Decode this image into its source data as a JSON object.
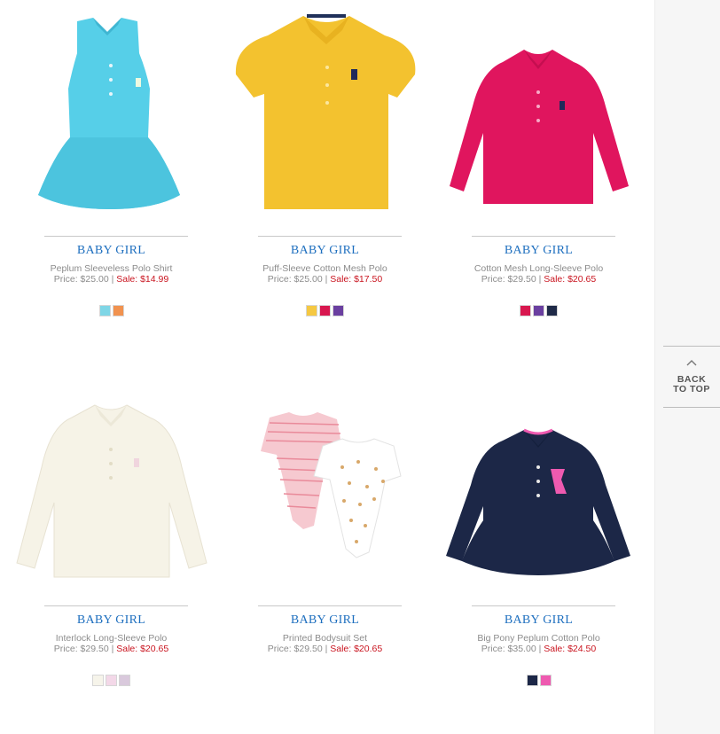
{
  "brand_color": "#1e6fbf",
  "sale_color": "#c9141f",
  "back_to_top": {
    "line1": "BACK",
    "line2": "TO TOP",
    "icon": "chevron-up-icon"
  },
  "products": [
    {
      "brand": "BABY GIRL",
      "name": "Peplum Sleeveless Polo Shirt",
      "price_label": "Price: $25.00",
      "separator": "|",
      "sale_label": "Sale: $14.99",
      "image": "turquoise sleeveless peplum polo",
      "swatches": [
        "#7fd6e6",
        "#f1924f"
      ]
    },
    {
      "brand": "BABY GIRL",
      "name": "Puff-Sleeve Cotton Mesh Polo",
      "price_label": "Price: $25.00",
      "separator": "|",
      "sale_label": "Sale: $17.50",
      "image": "yellow puff-sleeve polo",
      "swatches": [
        "#f5c842",
        "#d8174f",
        "#6a3fa0"
      ]
    },
    {
      "brand": "BABY GIRL",
      "name": "Cotton Mesh Long-Sleeve Polo",
      "price_label": "Price: $29.50",
      "separator": "|",
      "sale_label": "Sale: $20.65",
      "image": "pink long-sleeve polo",
      "swatches": [
        "#d8174f",
        "#6a3fa0",
        "#1f2a48"
      ]
    },
    {
      "brand": "BABY GIRL",
      "name": "Interlock Long-Sleeve Polo",
      "price_label": "Price: $29.50",
      "separator": "|",
      "sale_label": "Sale: $20.65",
      "image": "cream long-sleeve polo",
      "swatches": [
        "#f6f4ea",
        "#f3d8e8",
        "#d9c9dc"
      ]
    },
    {
      "brand": "BABY GIRL",
      "name": "Printed Bodysuit Set",
      "price_label": "Price: $29.50",
      "separator": "|",
      "sale_label": "Sale: $20.65",
      "image": "printed bodysuit set",
      "swatches": []
    },
    {
      "brand": "BABY GIRL",
      "name": "Big Pony Peplum Cotton Polo",
      "price_label": "Price: $35.00",
      "separator": "|",
      "sale_label": "Sale: $24.50",
      "image": "navy big pony peplum polo",
      "swatches": [
        "#1c2747",
        "#ee5ab0"
      ]
    }
  ]
}
